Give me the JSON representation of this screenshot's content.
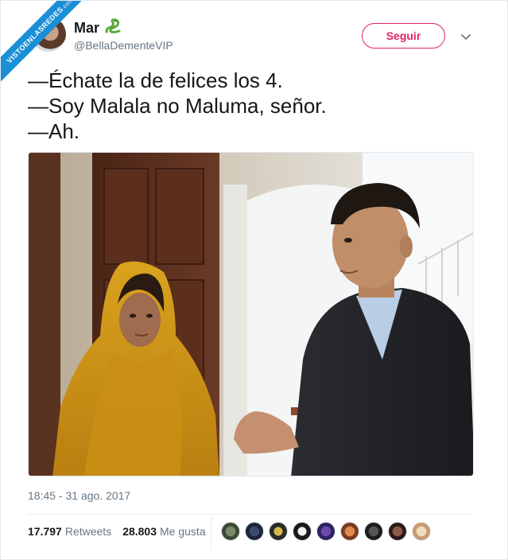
{
  "watermark": {
    "text": "VISTOENLASREDES",
    "suffix": ".com"
  },
  "user": {
    "display_name": "Mar",
    "handle": "@BellaDementeVIP"
  },
  "follow_button": {
    "label": "Seguir"
  },
  "tweet": {
    "lines": [
      "—Échate la de felices los 4.",
      "—Soy Malala no Maluma, señor.",
      "—Ah."
    ],
    "timestamp": "18:45 - 31 ago. 2017"
  },
  "stats": {
    "retweets_count": "17.797",
    "retweets_label": "Retweets",
    "likes_count": "28.803",
    "likes_label": "Me gusta"
  },
  "colors": {
    "accent": "#e0245e",
    "secondary_text": "#657786",
    "watermark_blue": "#1b8fd6"
  },
  "icons": {
    "more": "chevron-down-icon",
    "name_emoji": "snake-emoji"
  }
}
